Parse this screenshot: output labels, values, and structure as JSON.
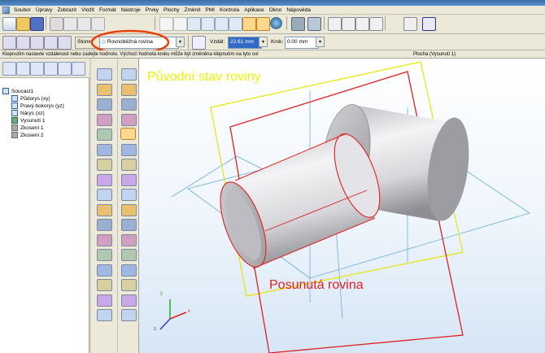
{
  "menu": {
    "items": [
      "Soubor",
      "Úpravy",
      "Zobrazit",
      "Vložit",
      "Formát",
      "Nástroje",
      "Prvky",
      "Plochy",
      "Změnit",
      "PMI",
      "Kontrola",
      "Aplikace",
      "Okno",
      "Nápověda"
    ]
  },
  "ribbon": {
    "stomo_label": "Stomo",
    "plane_option": "Rovnoběžná rovina",
    "distance_label": "Vzdál:",
    "distance_value": "22.61 mm",
    "step_label": "Krok:",
    "step_value": "0.00 mm"
  },
  "prompt": {
    "text": "Klepnutím nastavte vzdálenost nebo zadejte hodnotu. Výchozí hodnota kroku může být změněna klepnutím na tyto ovl",
    "view_text": "Plocha (Vysunutí 1)"
  },
  "tree": {
    "root": "Soucast1",
    "items": [
      "Půdorys (xy)",
      "Pravý bokorys (yz)",
      "Nárys (xz)",
      "Vysunutí 1",
      "Zkosení 1",
      "Zkosení 2"
    ]
  },
  "annotations": {
    "original_plane": "Původní stav roviny",
    "moved_plane": "Posunutá rovina"
  },
  "colors": {
    "annotation_yellow": "#f2f200",
    "annotation_red": "#e02020",
    "highlight_oval": "#e8420c",
    "ui_face": "#ece9d8"
  },
  "axes": {
    "x": "x",
    "y": "y",
    "z": "z"
  }
}
